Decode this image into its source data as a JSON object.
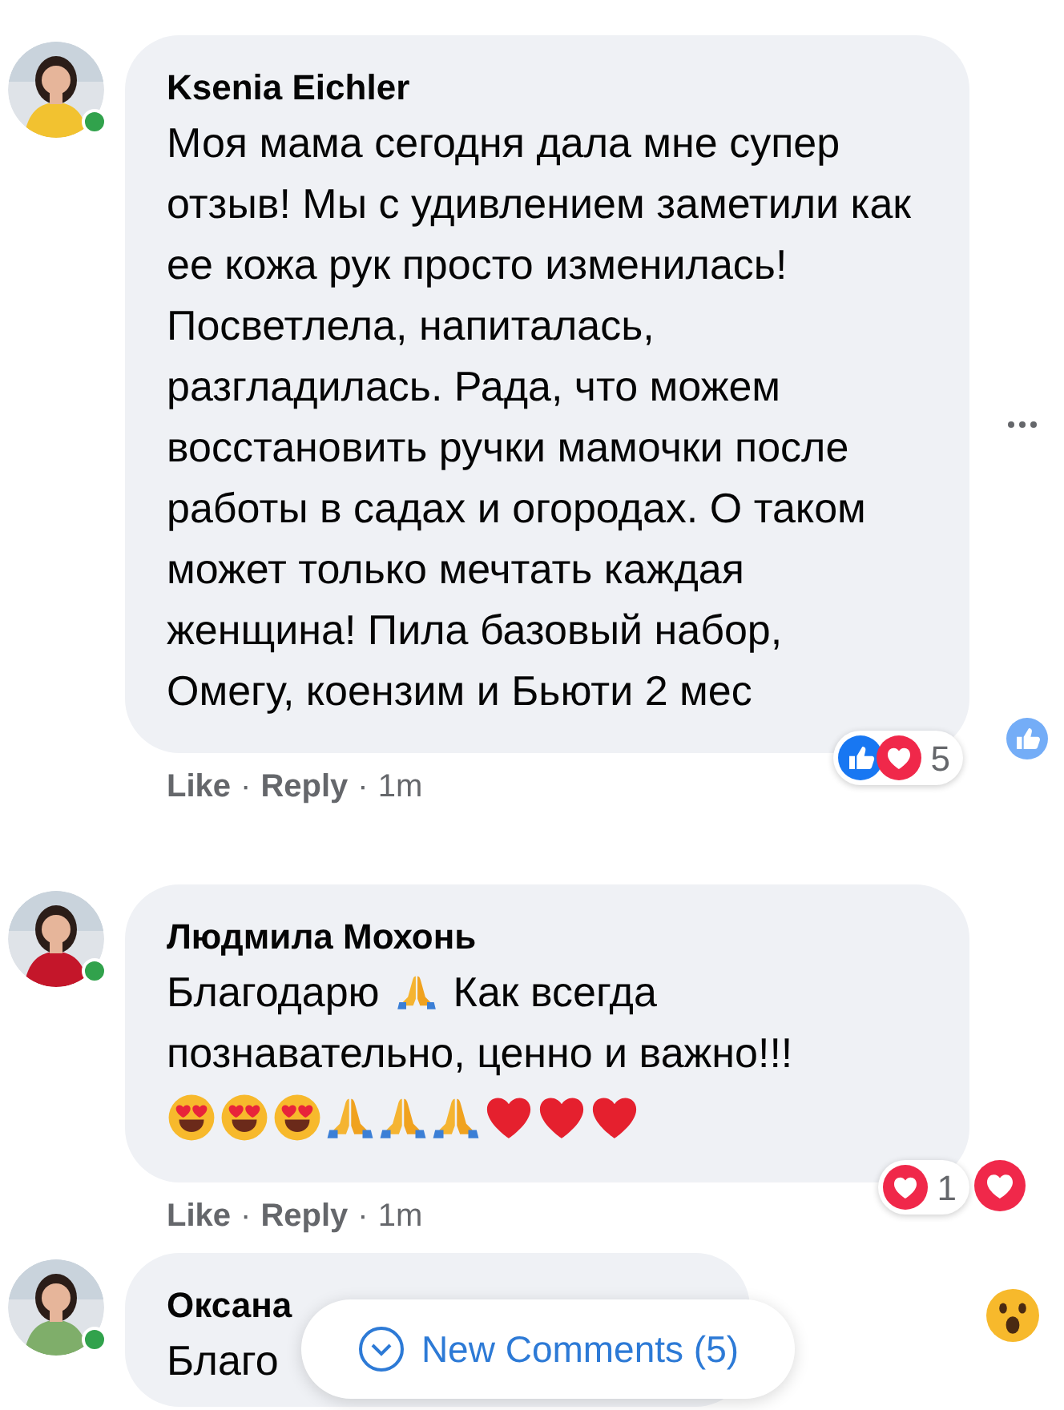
{
  "comments": [
    {
      "author": "Ksenia Eichler",
      "online": true,
      "lines": [
        [
          {
            "kind": "text",
            "text": "Моя мама сегодня дала мне супер отзыв! Мы с удивлением заметили как ее кожа рук просто изменилась! Посветлела, напиталась, разгладилась. Рада, что можем восстановить ручки мамочки после работы в садах и огородах. О таком может только мечтать каждая женщина! Пила базовый набор, Омегу, коензим и Бьюти 2 мес"
          }
        ]
      ],
      "actions": [
        {
          "kind": "link",
          "text": "Like"
        },
        {
          "kind": "separator",
          "text": "·"
        },
        {
          "kind": "link",
          "text": "Reply"
        },
        {
          "kind": "separator",
          "text": "·"
        },
        {
          "kind": "time",
          "text": "1m"
        }
      ],
      "reactions": {
        "icons": [
          {
            "kind": "like"
          },
          {
            "kind": "heart"
          }
        ],
        "count": "5"
      }
    },
    {
      "author": "Людмила Мохонь",
      "online": true,
      "lines": [
        [
          {
            "kind": "text",
            "text": "Благодарю"
          },
          {
            "kind": "pray"
          },
          {
            "kind": "text",
            "text": "Как всегда"
          }
        ],
        [
          {
            "kind": "text",
            "text": "познавательно, ценно и важно!!!"
          }
        ],
        [
          {
            "kind": "heart_eyes"
          },
          {
            "kind": "heart_eyes"
          },
          {
            "kind": "heart_eyes"
          },
          {
            "kind": "pray"
          },
          {
            "kind": "pray"
          },
          {
            "kind": "pray"
          },
          {
            "kind": "red_heart"
          },
          {
            "kind": "red_heart"
          },
          {
            "kind": "red_heart"
          }
        ]
      ],
      "actions": [
        {
          "kind": "link",
          "text": "Like"
        },
        {
          "kind": "separator",
          "text": "·"
        },
        {
          "kind": "link",
          "text": "Reply"
        },
        {
          "kind": "separator",
          "text": "·"
        },
        {
          "kind": "time",
          "text": "1m"
        }
      ],
      "reactions": {
        "icons": [
          {
            "kind": "heart"
          }
        ],
        "count": "1"
      }
    },
    {
      "author": "Оксана",
      "online": true,
      "lines": [
        [
          {
            "kind": "text",
            "text": "Благо"
          }
        ]
      ]
    }
  ],
  "side_icons": [
    {
      "kind": "more"
    },
    {
      "kind": "like"
    },
    {
      "kind": "heart"
    },
    {
      "kind": "wow"
    }
  ],
  "new_comments_button": {
    "label": "New Comments (5)"
  }
}
